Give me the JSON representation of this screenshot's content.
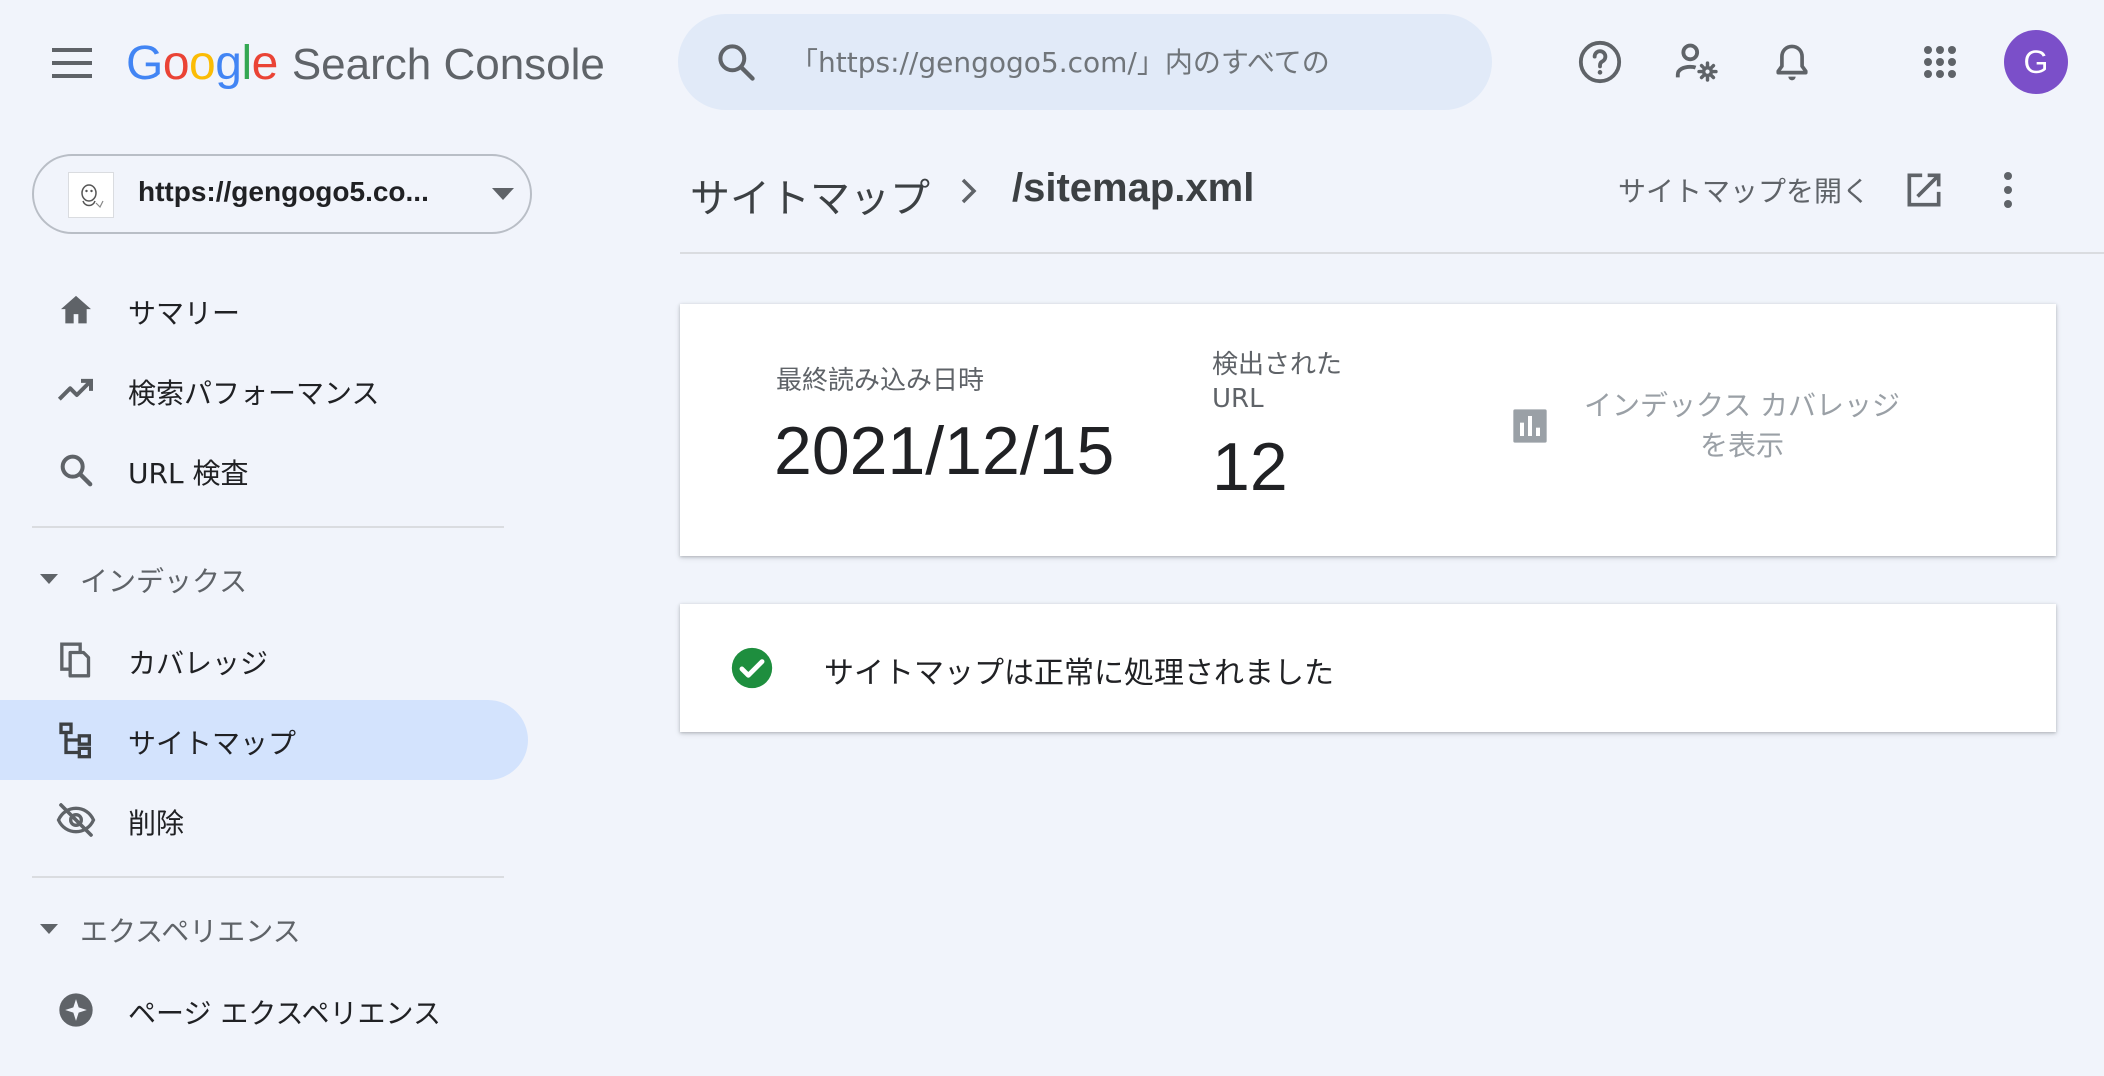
{
  "header": {
    "logo_google": [
      "G",
      "o",
      "o",
      "g",
      "l",
      "e"
    ],
    "logo_product": "Search Console",
    "search_placeholder": "「https://gengogo5.com/」内のすべての",
    "avatar_letter": "G",
    "icons": [
      "menu-icon",
      "search-icon",
      "help-icon",
      "manage-users-icon",
      "notifications-icon",
      "apps-icon"
    ]
  },
  "sidebar": {
    "property": "https://gengogo5.co...",
    "items": [
      {
        "label": "サマリー",
        "icon": "home-icon"
      },
      {
        "label": "検索パフォーマンス",
        "icon": "trending-up-icon"
      },
      {
        "label": "URL 検査",
        "icon": "search-icon"
      }
    ],
    "section_index": {
      "label": "インデックス",
      "items": [
        {
          "label": "カバレッジ",
          "icon": "copy-icon"
        },
        {
          "label": "サイトマップ",
          "icon": "sitemap-icon",
          "active": true
        },
        {
          "label": "削除",
          "icon": "visibility-off-icon"
        }
      ]
    },
    "section_experience": {
      "label": "エクスペリエンス",
      "items": [
        {
          "label": "ページ エクスペリエンス",
          "icon": "page-experience-icon"
        }
      ]
    }
  },
  "main": {
    "breadcrumb": {
      "parent": "サイトマップ",
      "current": "/sitemap.xml"
    },
    "open_sitemap_label": "サイトマップを開く",
    "metrics": {
      "last_read_label": "最終読み込み日時",
      "last_read_value": "2021/12/15",
      "discovered_label": "検出された URL",
      "discovered_value": "12"
    },
    "coverage_link_label": "インデックス カバレッジを表示",
    "status_text": "サイトマップは正常に処理されました"
  },
  "colors": {
    "background": "#f1f4fb",
    "active_nav": "#d3e3fd",
    "search_bg": "#e1eaf8",
    "avatar": "#7b4fc9",
    "success": "#1e8e3e",
    "google_blue": "#4285f4",
    "google_red": "#ea4335",
    "google_yellow": "#fbbc05",
    "google_green": "#34a853"
  }
}
